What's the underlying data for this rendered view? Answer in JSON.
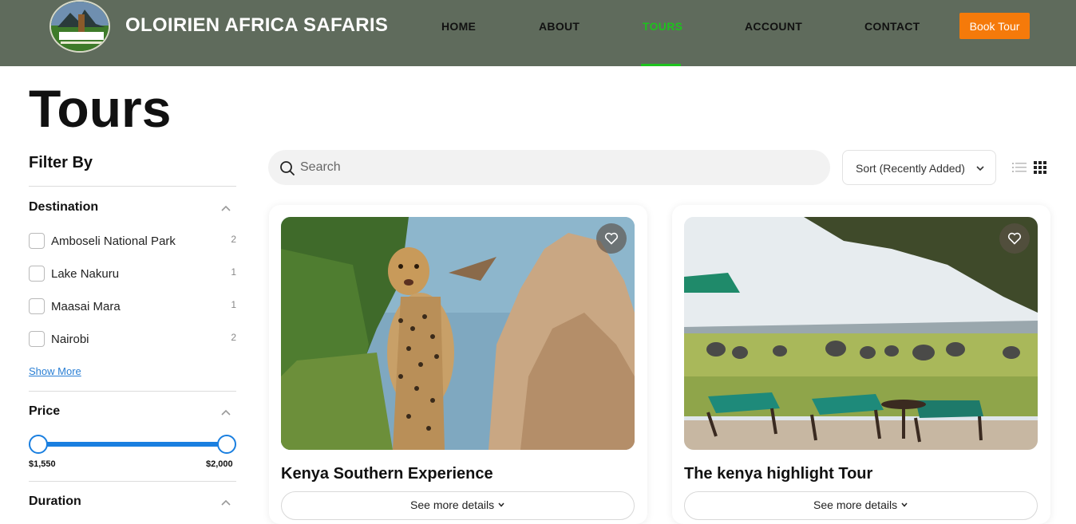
{
  "header": {
    "brand": "OLOIRIEN AFRICA SAFARIS",
    "nav": [
      {
        "label": "HOME",
        "active": false
      },
      {
        "label": "ABOUT",
        "active": false
      },
      {
        "label": "TOURS",
        "active": true
      },
      {
        "label": "ACCOUNT",
        "active": false
      },
      {
        "label": "CONTACT",
        "active": false
      }
    ],
    "book_button": "Book Tour",
    "colors": {
      "bar": "#5f6b5c",
      "active": "#1ec21e",
      "cta": "#f57a0a"
    }
  },
  "page": {
    "title": "Tours"
  },
  "sidebar": {
    "filter_title": "Filter By",
    "destination": {
      "title": "Destination",
      "items": [
        {
          "label": "Amboseli National Park",
          "count": "2"
        },
        {
          "label": "Lake Nakuru",
          "count": "1"
        },
        {
          "label": "Maasai Mara",
          "count": "1"
        },
        {
          "label": "Nairobi",
          "count": "2"
        }
      ],
      "show_more": "Show More"
    },
    "price": {
      "title": "Price",
      "min": "$1,550",
      "max": "$2,000"
    },
    "duration": {
      "title": "Duration"
    }
  },
  "toolbar": {
    "search_placeholder": "Search",
    "sort_label": "Sort (Recently Added)",
    "view_modes": [
      "list-view-icon",
      "grid-view-icon"
    ]
  },
  "tours": [
    {
      "title": "Kenya Southern Experience",
      "details_label": "See more details",
      "image": "leopard-on-termite-mound"
    },
    {
      "title": "The kenya highlight Tour",
      "details_label": "See more details",
      "image": "elephants-and-lodge-loungers"
    }
  ]
}
